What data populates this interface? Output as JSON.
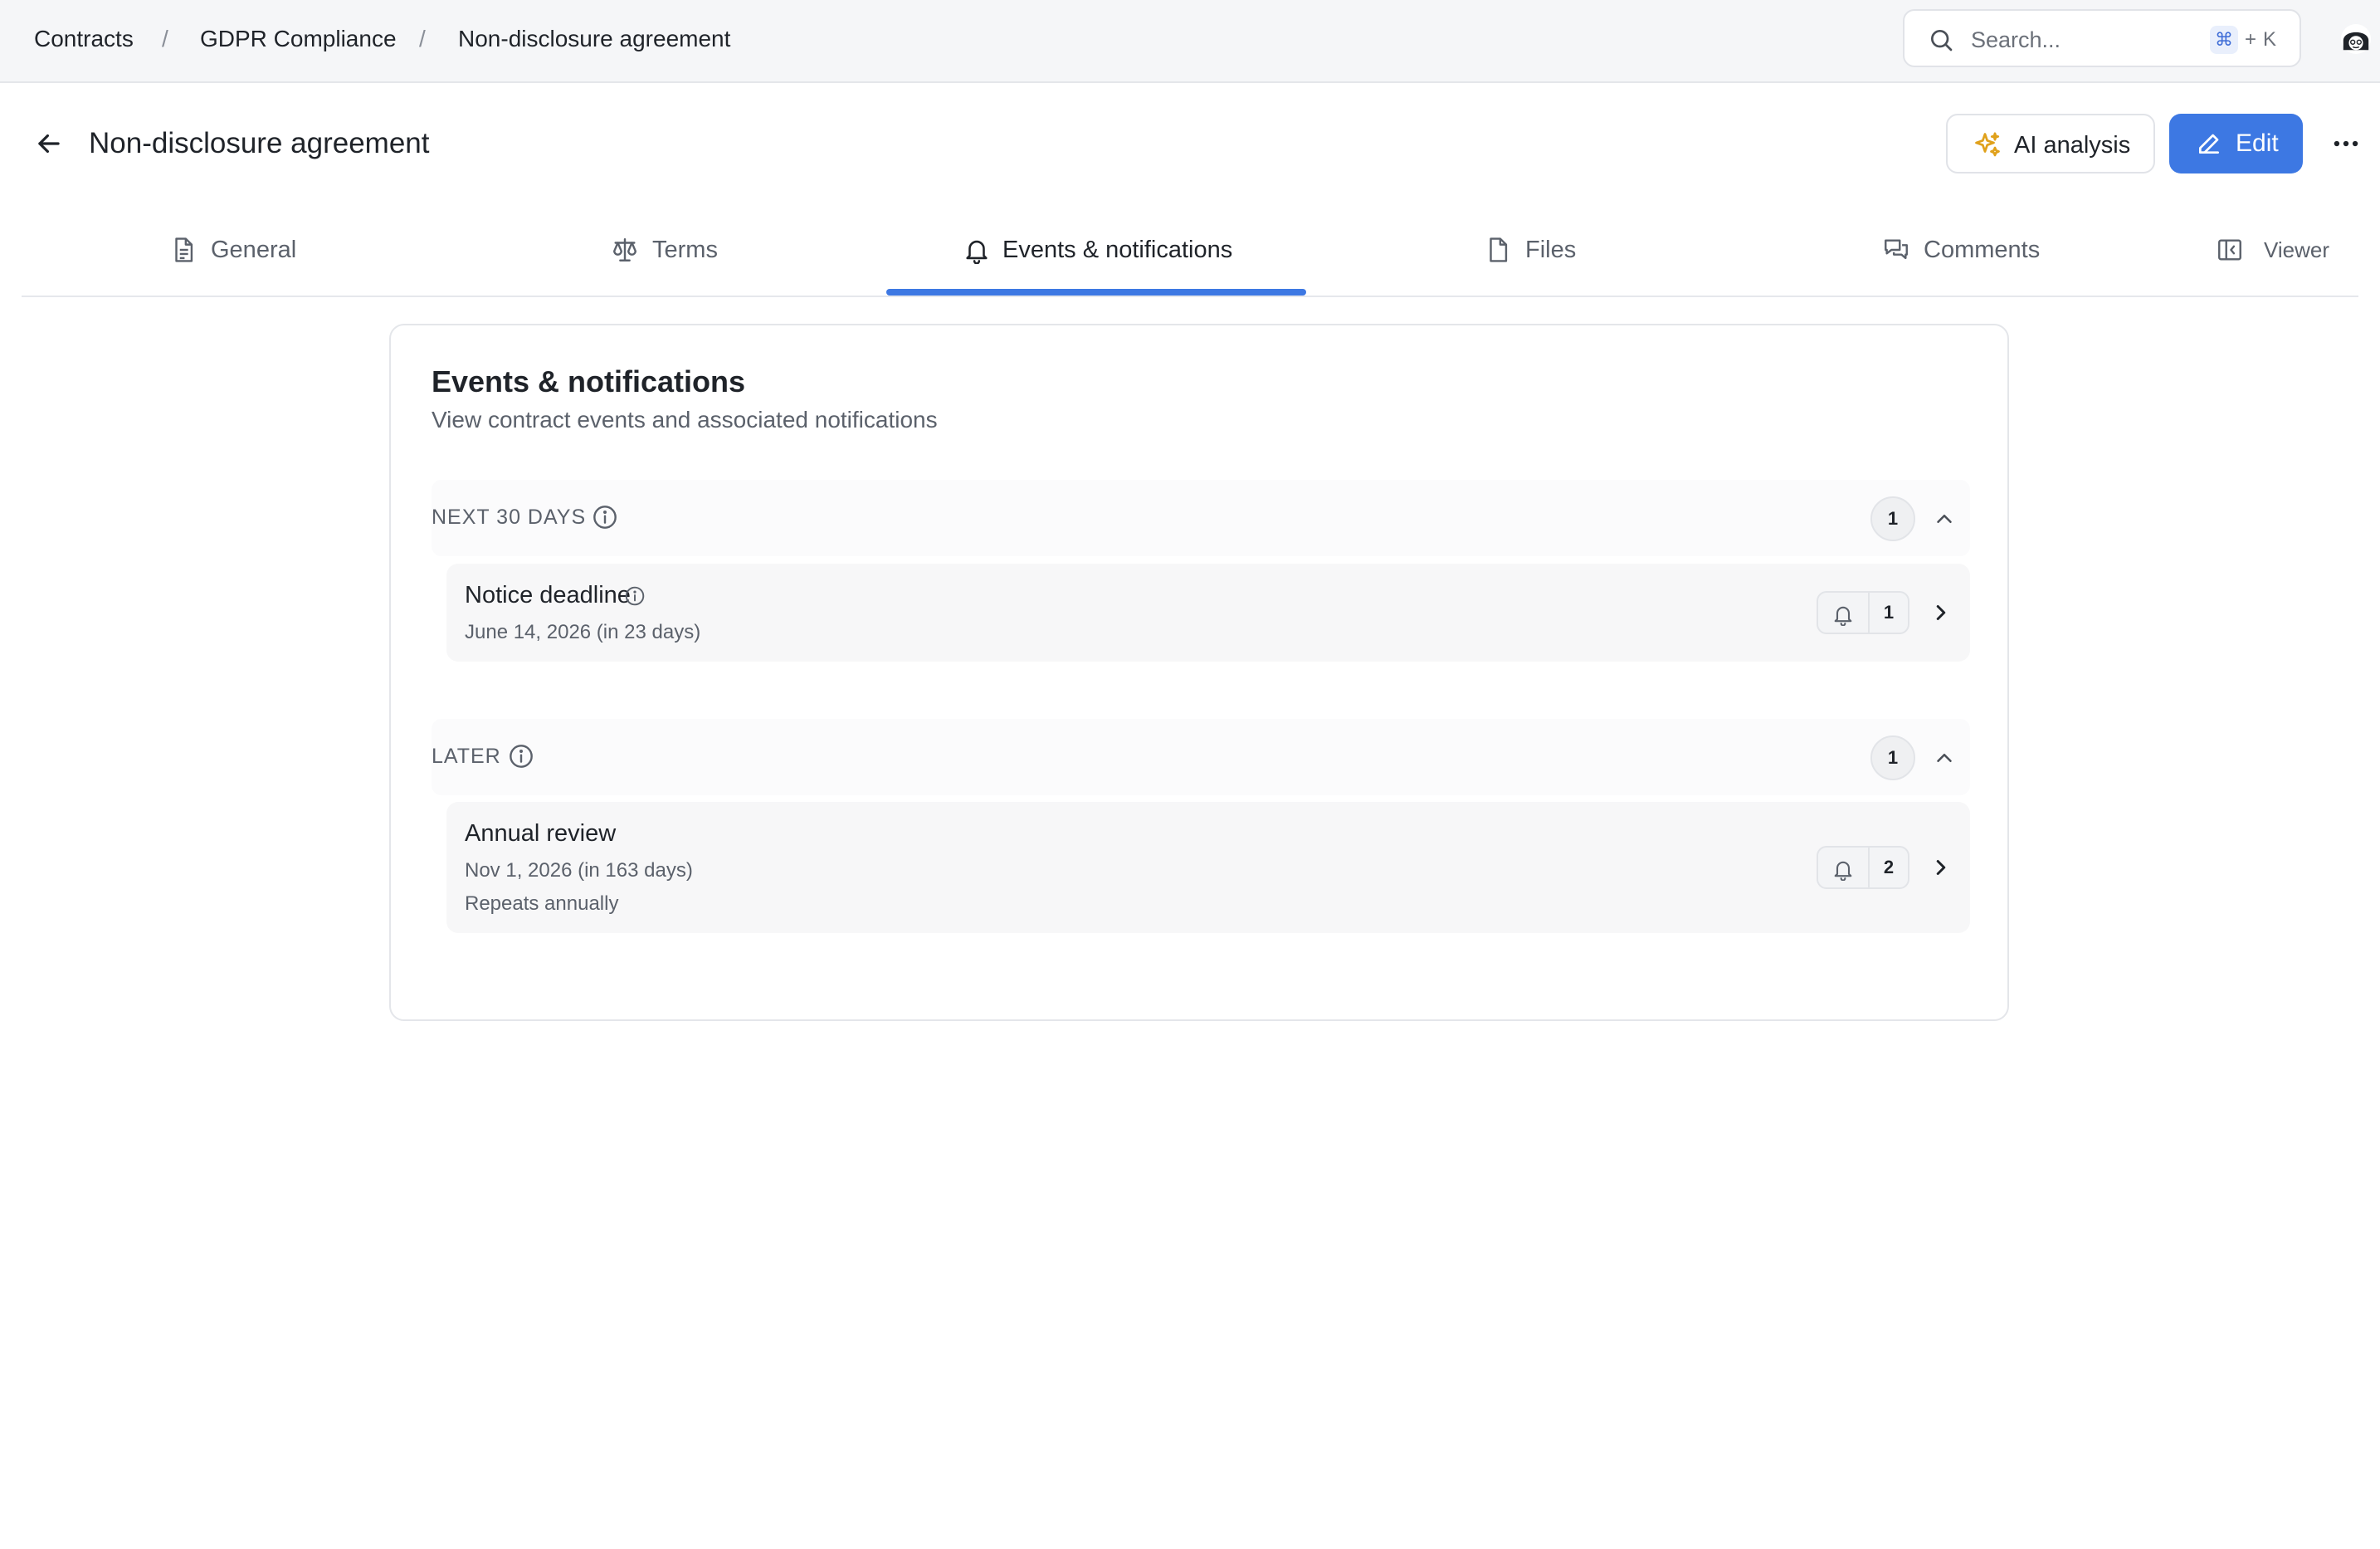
{
  "breadcrumb": {
    "items": [
      "Contracts",
      "GDPR Compliance",
      "Non-disclosure agreement"
    ],
    "separator": "/"
  },
  "search": {
    "placeholder": "Search...",
    "shortcut_cmd": "⌘",
    "shortcut_plus": "+",
    "shortcut_key": "K",
    "icon": "search-icon"
  },
  "header": {
    "title": "Non-disclosure agreement",
    "ai_button": "AI analysis",
    "edit_button": "Edit"
  },
  "tabs": [
    {
      "label": "General",
      "icon": "document-icon"
    },
    {
      "label": "Terms",
      "icon": "scale-icon"
    },
    {
      "label": "Events & notifications",
      "icon": "bell-icon",
      "active": true
    },
    {
      "label": "Files",
      "icon": "file-icon"
    },
    {
      "label": "Comments",
      "icon": "comments-icon"
    },
    {
      "label": "Viewer",
      "icon": "panel-icon"
    }
  ],
  "card": {
    "title": "Events & notifications",
    "subtitle": "View contract events and associated notifications"
  },
  "groups": [
    {
      "label": "NEXT 30 DAYS",
      "count": "1",
      "events": [
        {
          "title": "Notice deadline",
          "date": "June 14, 2026 (in 23 days)",
          "repeat": "",
          "notifications": "1"
        }
      ]
    },
    {
      "label": "LATER",
      "count": "1",
      "events": [
        {
          "title": "Annual review",
          "date": "Nov 1, 2026 (in 163 days)",
          "repeat": "Repeats annually",
          "notifications": "2"
        }
      ]
    }
  ],
  "colors": {
    "accent": "#3d78e3",
    "sparkle": "#e0a11b"
  }
}
